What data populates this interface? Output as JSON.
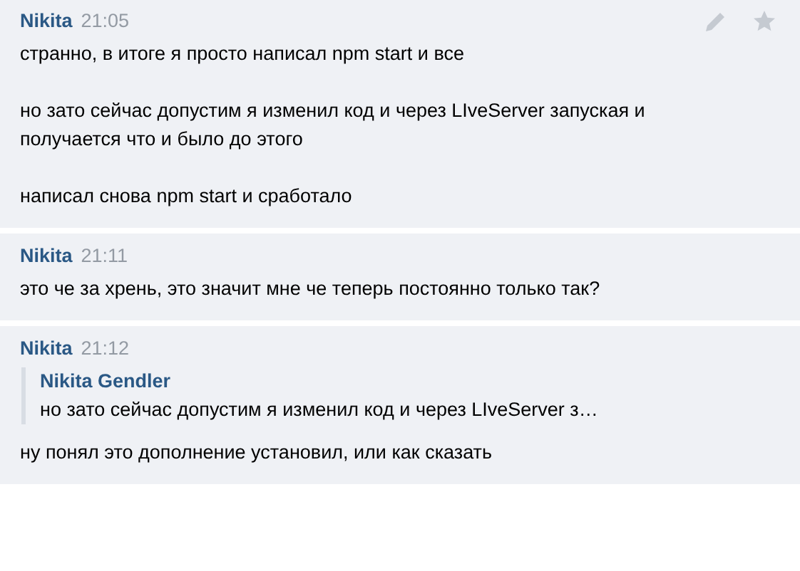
{
  "messages": [
    {
      "author": "Nikita",
      "time": "21:05",
      "hovered": true,
      "paragraphs": [
        "странно, в итоге я просто написал npm start и все",
        "но зато сейчас допустим я изменил код и через LIveServer запуская и получается что и было до этого",
        "написал снова npm start и сработало"
      ]
    },
    {
      "author": "Nikita",
      "time": "21:11",
      "hovered": false,
      "paragraphs": [
        "это че за хрень, это значит мне че теперь постоянно только так?"
      ]
    },
    {
      "author": "Nikita",
      "time": "21:12",
      "hovered": false,
      "quote": {
        "author": "Nikita Gendler",
        "text": "но зато сейчас допустим я изменил код и через LIveServer з…"
      },
      "paragraphs": [
        "ну понял это дополнение установил, или как сказать"
      ]
    }
  ]
}
